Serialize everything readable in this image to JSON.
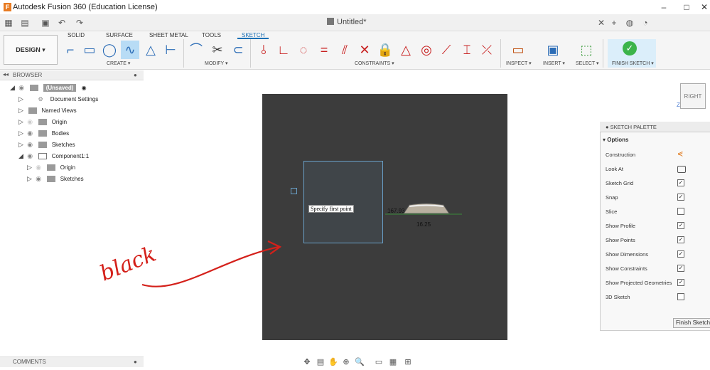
{
  "app": {
    "title": "Autodesk Fusion 360 (Education License)",
    "logo_letter": "F",
    "window_controls": [
      "–",
      "□",
      "✕"
    ]
  },
  "tabbar": {
    "document_title": "Untitled*"
  },
  "ribbon": {
    "workspace": "DESIGN ▾",
    "tabs": [
      "SOLID",
      "SURFACE",
      "SHEET METAL",
      "TOOLS",
      "SKETCH"
    ],
    "active_tab": "SKETCH",
    "groups": {
      "create": "CREATE ▾",
      "modify": "MODIFY ▾",
      "constraints": "CONSTRAINTS ▾",
      "inspect": "INSPECT ▾",
      "insert": "INSERT ▾",
      "select": "SELECT ▾",
      "finish": "FINISH SKETCH ▾"
    }
  },
  "browser": {
    "title": "BROWSER",
    "root": "(Unsaved)",
    "items": [
      {
        "label": "Document Settings"
      },
      {
        "label": "Named Views"
      },
      {
        "label": "Origin"
      },
      {
        "label": "Bodies"
      },
      {
        "label": "Sketches"
      },
      {
        "label": "Component1:1"
      },
      {
        "label": "Origin"
      },
      {
        "label": "Sketches"
      }
    ]
  },
  "canvas": {
    "tooltip": "Specify first point",
    "dim1": "167.93",
    "dim2": "16.25",
    "annotation": "black"
  },
  "viewcube": {
    "face": "RIGHT",
    "axis": "Z"
  },
  "palette": {
    "title": "SKETCH PALETTE",
    "section": "Options",
    "rows": [
      {
        "label": "Construction",
        "checked": null
      },
      {
        "label": "Look At",
        "checked": null
      },
      {
        "label": "Sketch Grid",
        "checked": true
      },
      {
        "label": "Snap",
        "checked": true
      },
      {
        "label": "Slice",
        "checked": false
      },
      {
        "label": "Show Profile",
        "checked": true
      },
      {
        "label": "Show Points",
        "checked": true
      },
      {
        "label": "Show Dimensions",
        "checked": true
      },
      {
        "label": "Show Constraints",
        "checked": true
      },
      {
        "label": "Show Projected Geometries",
        "checked": true
      },
      {
        "label": "3D Sketch",
        "checked": false
      }
    ],
    "finish_button": "Finish Sketch"
  },
  "comments": {
    "title": "COMMENTS"
  },
  "colors": {
    "accent": "#1a6fb5",
    "annotation_red": "#d4201a",
    "canvas_bg": "#3c3c3c"
  }
}
